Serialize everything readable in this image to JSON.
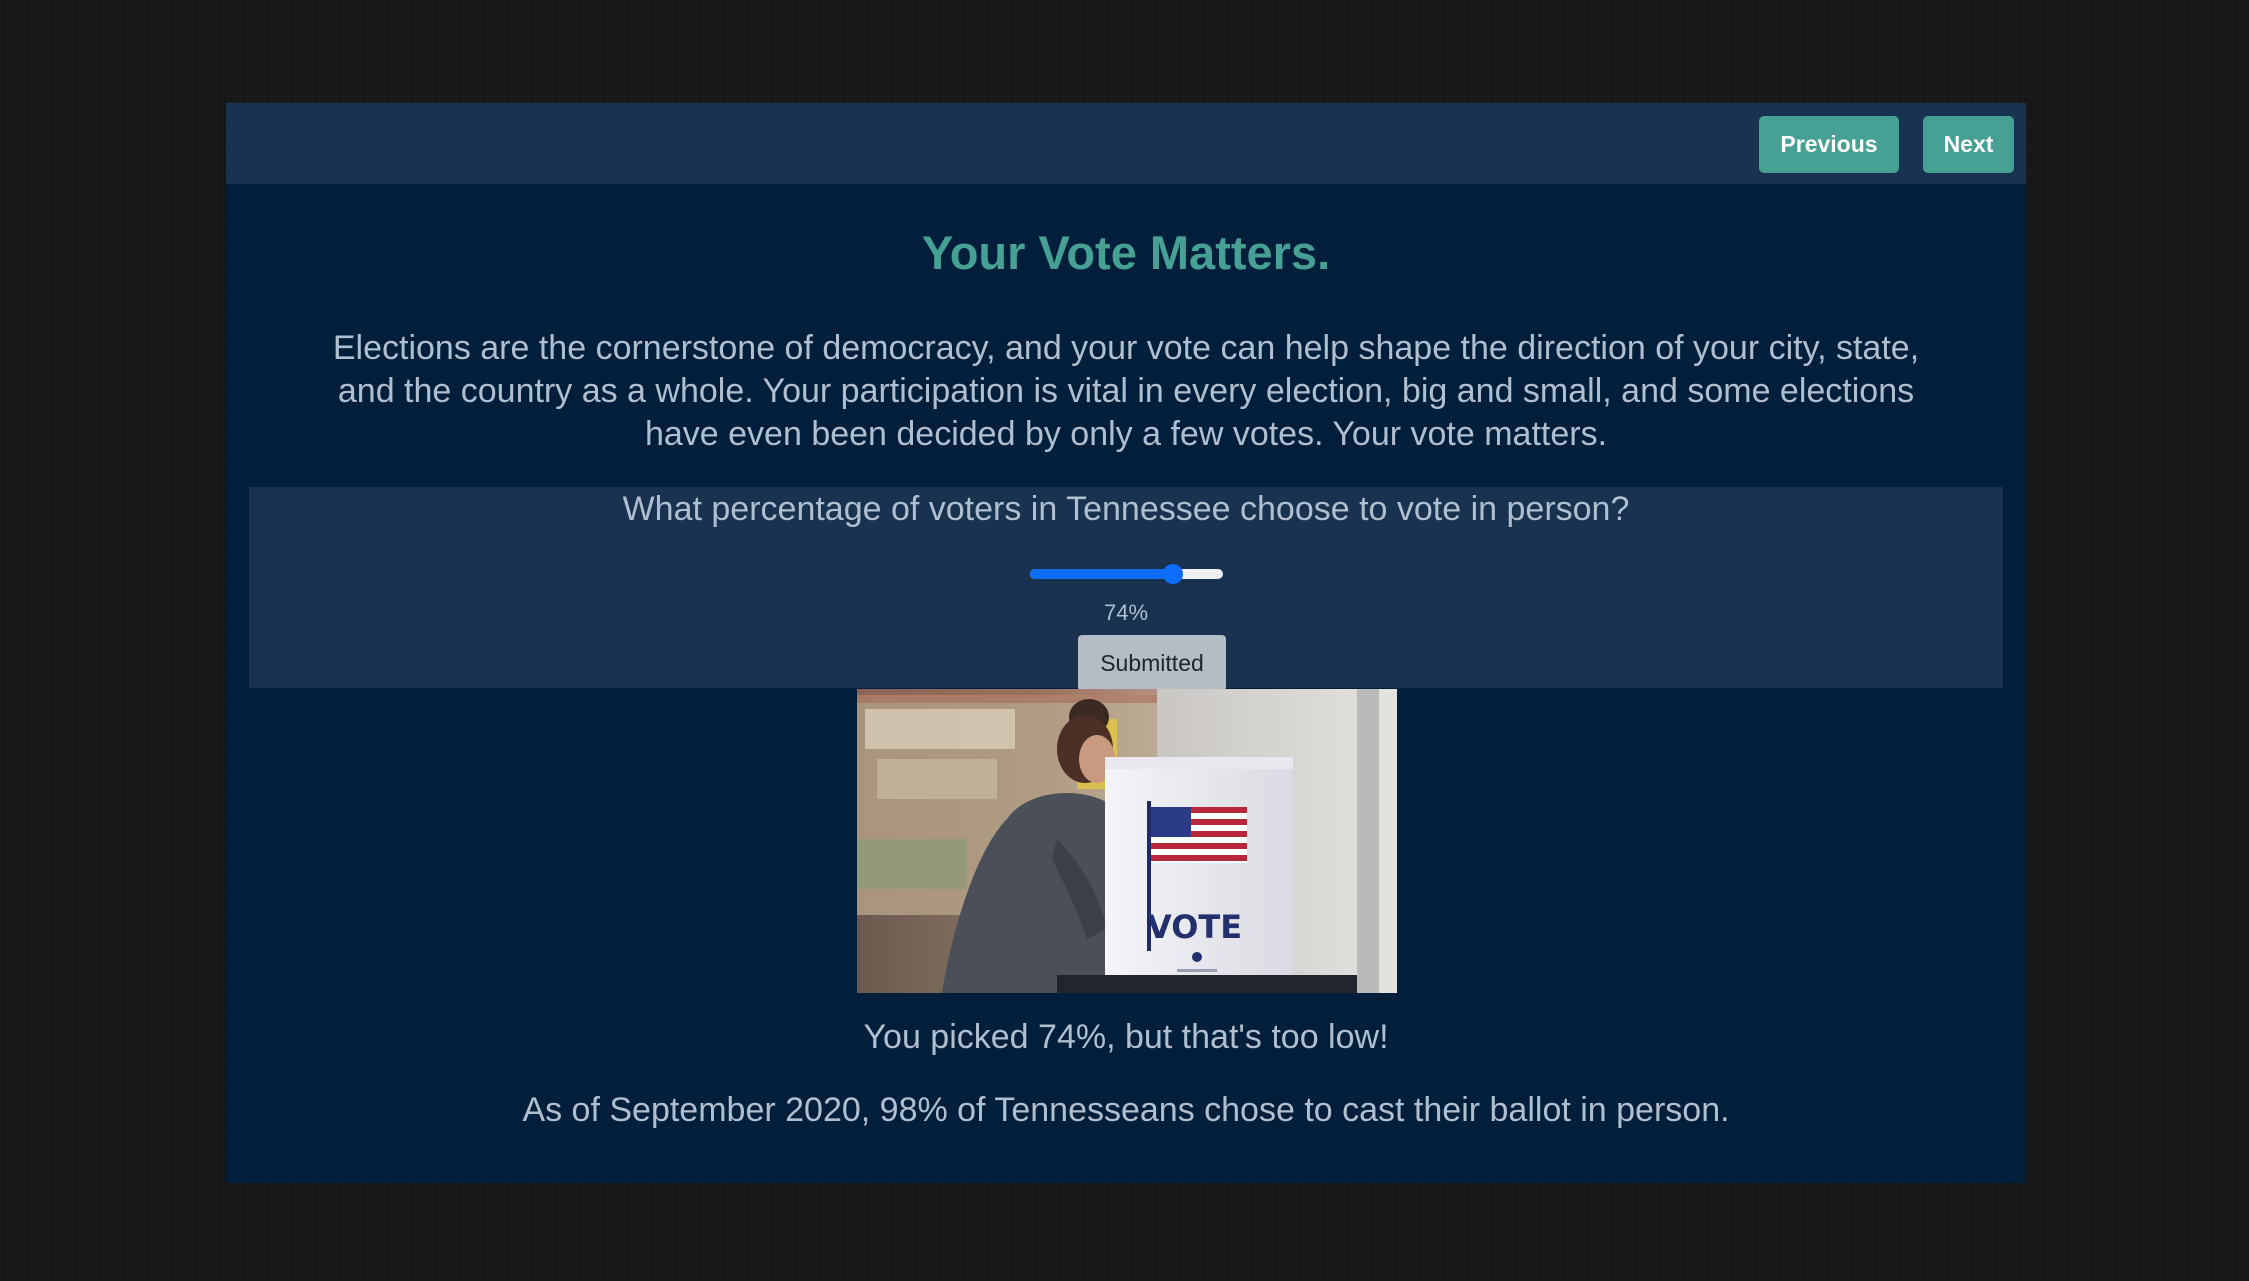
{
  "nav": {
    "previous_label": "Previous",
    "next_label": "Next"
  },
  "page": {
    "title": "Your Vote Matters.",
    "intro": "Elections are the cornerstone of democracy, and your vote can help shape the direction of your city, state, and the country as a whole. Your participation is vital in every election, big and small, and some elections have even been decided by only a few votes. Your vote matters."
  },
  "quiz": {
    "question": "What percentage of voters in Tennessee choose to vote in person?",
    "slider_value": 74,
    "slider_value_label": "74%",
    "submit_label": "Submitted",
    "accent_color": "#0d6efd"
  },
  "photo": {
    "booth_text": "VOTE"
  },
  "feedback": {
    "result": "You picked 74%, but that's too low!",
    "fact": "As of September 2020, 98% of Tennesseans chose to cast their ballot in person."
  },
  "colors": {
    "background": "#011f3a",
    "panel": "#19324f",
    "accent": "#46a194",
    "text": "#b0bfd0"
  }
}
